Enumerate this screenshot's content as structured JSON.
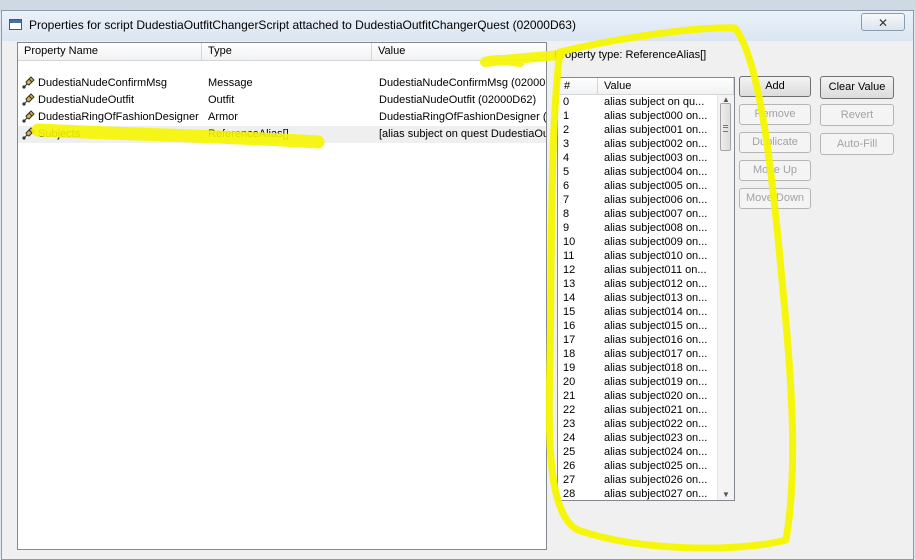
{
  "window": {
    "title": "Properties for script DudestiaOutfitChangerScript attached to DudestiaOutfitChangerQuest (02000D63)",
    "close_glyph": "✕"
  },
  "property_list": {
    "columns": [
      "Property Name",
      "Type",
      "Value"
    ],
    "rows": [
      {
        "name": "DudestiaNudeConfirmMsg",
        "type": "Message",
        "value": "DudestiaNudeConfirmMsg (02000D",
        "icon": "property-icon"
      },
      {
        "name": "DudestiaNudeOutfit",
        "type": "Outfit",
        "value": "DudestiaNudeOutfit (02000D62)",
        "icon": "property-icon"
      },
      {
        "name": "DudestiaRingOfFashionDesigner",
        "type": "Armor",
        "value": "DudestiaRingOfFashionDesigner (0",
        "icon": "property-icon"
      },
      {
        "name": "Subjects",
        "type": "ReferenceAlias[]",
        "value": "[alias subject on quest DudestiaOu",
        "icon": "property-icon"
      }
    ]
  },
  "array_panel": {
    "property_type_label": "Property type: ReferenceAlias[]",
    "columns": [
      "#",
      "Value"
    ],
    "rows": [
      {
        "index": "0",
        "value": "alias subject on qu..."
      },
      {
        "index": "1",
        "value": "alias subject000 on..."
      },
      {
        "index": "2",
        "value": "alias subject001 on..."
      },
      {
        "index": "3",
        "value": "alias subject002 on..."
      },
      {
        "index": "4",
        "value": "alias subject003 on..."
      },
      {
        "index": "5",
        "value": "alias subject004 on..."
      },
      {
        "index": "6",
        "value": "alias subject005 on..."
      },
      {
        "index": "7",
        "value": "alias subject006 on..."
      },
      {
        "index": "8",
        "value": "alias subject007 on..."
      },
      {
        "index": "9",
        "value": "alias subject008 on..."
      },
      {
        "index": "10",
        "value": "alias subject009 on..."
      },
      {
        "index": "11",
        "value": "alias subject010 on..."
      },
      {
        "index": "12",
        "value": "alias subject011 on..."
      },
      {
        "index": "13",
        "value": "alias subject012 on..."
      },
      {
        "index": "14",
        "value": "alias subject013 on..."
      },
      {
        "index": "15",
        "value": "alias subject014 on..."
      },
      {
        "index": "16",
        "value": "alias subject015 on..."
      },
      {
        "index": "17",
        "value": "alias subject016 on..."
      },
      {
        "index": "18",
        "value": "alias subject017 on..."
      },
      {
        "index": "19",
        "value": "alias subject018 on..."
      },
      {
        "index": "20",
        "value": "alias subject019 on..."
      },
      {
        "index": "21",
        "value": "alias subject020 on..."
      },
      {
        "index": "22",
        "value": "alias subject021 on..."
      },
      {
        "index": "23",
        "value": "alias subject022 on..."
      },
      {
        "index": "24",
        "value": "alias subject023 on..."
      },
      {
        "index": "25",
        "value": "alias subject024 on..."
      },
      {
        "index": "26",
        "value": "alias subject025 on..."
      },
      {
        "index": "27",
        "value": "alias subject026 on..."
      },
      {
        "index": "28",
        "value": "alias subject027 on..."
      }
    ],
    "buttons": {
      "add": "Add",
      "remove": "Remove",
      "duplicate": "Duplicate",
      "move_up": "Move Up",
      "move_down": "Move Down"
    }
  },
  "right_buttons": {
    "clear_value": "Clear Value",
    "revert": "Revert",
    "auto_fill": "Auto-Fill"
  },
  "colors": {
    "highlight": "#f5f500",
    "window_bg": "#f0f0f0",
    "disabled_text": "#a3a3a3"
  }
}
